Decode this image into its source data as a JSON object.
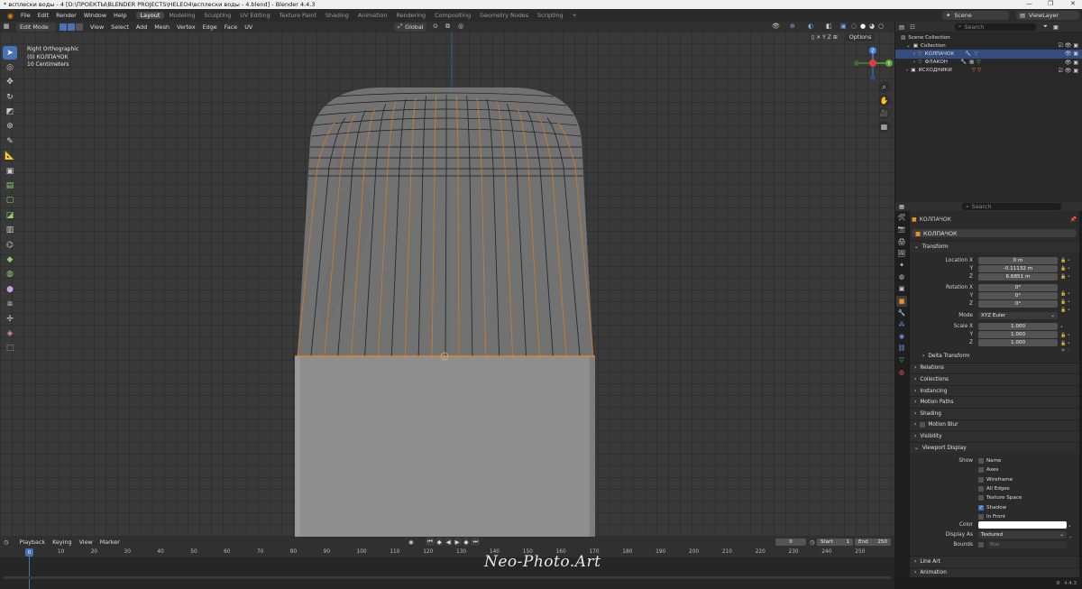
{
  "window": {
    "title": "* всплески воды - 4 [D:\\ПРОЕКТЫ\\BLENDER PROJECTS\\HELEO4\\всплески воды - 4.blend] - Blender 4.4.3"
  },
  "menu": {
    "items": [
      "File",
      "Edit",
      "Render",
      "Window",
      "Help"
    ]
  },
  "workspaces": {
    "tabs": [
      "Layout",
      "Modeling",
      "Sculpting",
      "UV Editing",
      "Texture Paint",
      "Shading",
      "Animation",
      "Rendering",
      "Compositing",
      "Geometry Nodes",
      "Scripting"
    ],
    "add": "+"
  },
  "topright": {
    "scene": "Scene",
    "view_layer": "ViewLayer"
  },
  "viewport_header": {
    "mode": "Edit Mode",
    "menus": [
      "View",
      "Select",
      "Add",
      "Mesh",
      "Vertex",
      "Edge",
      "Face",
      "UV"
    ],
    "transform_orientation": "Global",
    "options": "Options"
  },
  "viewport_info": {
    "line1": "Right Orthographic",
    "line2": "(0) КОЛПАЧОК",
    "line3": "10 Centimeters"
  },
  "gizmo": {
    "z": "Z",
    "y": "Y"
  },
  "outliner": {
    "search_placeholder": "Search",
    "rows": [
      {
        "label": "Scene Collection"
      },
      {
        "label": "Collection"
      },
      {
        "label": "КОЛПАЧОК"
      },
      {
        "label": "ФЛАКОН"
      },
      {
        "label": "ИСХОДНИКИ"
      }
    ]
  },
  "properties": {
    "search_placeholder": "Search",
    "object_name": "КОЛПАЧОК",
    "object_datablock": "КОЛПАЧОК",
    "transform_header": "Transform",
    "location": {
      "label": "Location X",
      "x": "0 m",
      "y": "-0.11132 m",
      "z": "6.6851 m"
    },
    "rotation": {
      "label": "Rotation X",
      "x": "0°",
      "y": "0°",
      "z": "0°"
    },
    "mode": {
      "label": "Mode",
      "value": "XYZ Euler"
    },
    "scale": {
      "label": "Scale X",
      "x": "1.000",
      "y": "1.000",
      "z": "1.000"
    },
    "axis": {
      "y": "Y",
      "z": "Z"
    },
    "sections": [
      "Delta Transform",
      "Relations",
      "Collections",
      "Instancing",
      "Motion Paths",
      "Shading",
      "Motion Blur",
      "Visibility",
      "Viewport Display"
    ],
    "viewport_display": {
      "show_label": "Show",
      "checks": [
        {
          "label": "Name",
          "on": false
        },
        {
          "label": "Axes",
          "on": false
        },
        {
          "label": "Wireframe",
          "on": false
        },
        {
          "label": "All Edges",
          "on": false
        },
        {
          "label": "Texture Space",
          "on": false
        },
        {
          "label": "Shadow",
          "on": true
        },
        {
          "label": "In Front",
          "on": false
        }
      ],
      "color_label": "Color",
      "display_as_label": "Display As",
      "display_as_value": "Textured",
      "bounds_label": "Bounds",
      "bounds_value": "Box"
    },
    "bottom_sections": [
      "Line Art",
      "Animation"
    ]
  },
  "timeline": {
    "menus": [
      "Playback",
      "Keying",
      "View",
      "Marker"
    ],
    "current_frame": "0",
    "start_label": "Start",
    "start": "1",
    "end_label": "End",
    "end": "250",
    "ruler_marks": [
      "0",
      "10",
      "20",
      "30",
      "40",
      "50",
      "60",
      "70",
      "80",
      "90",
      "100",
      "110",
      "120",
      "130",
      "140",
      "150",
      "160",
      "170",
      "180",
      "190",
      "200",
      "210",
      "220",
      "230",
      "240",
      "250"
    ],
    "playhead_label": "0"
  },
  "watermark": "Neo-Photo.Art",
  "status": {
    "version": "4.4.3"
  }
}
